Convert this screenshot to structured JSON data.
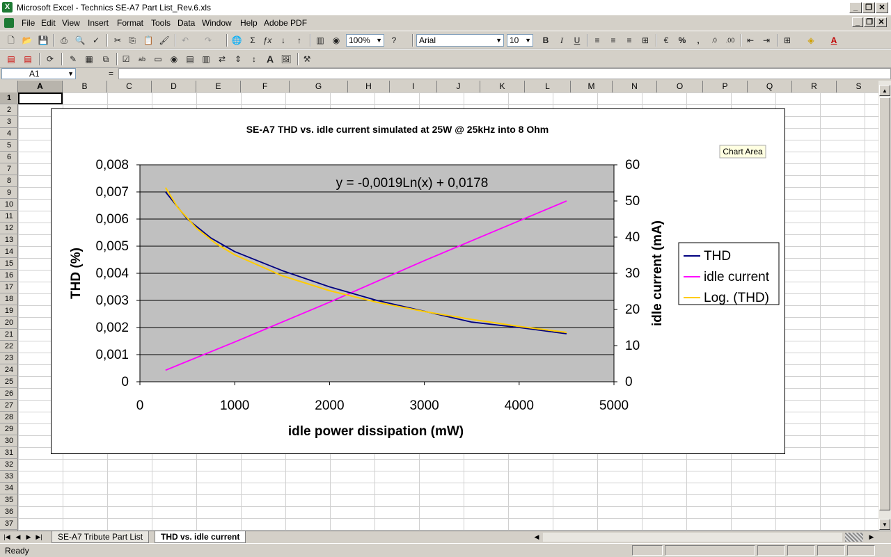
{
  "window": {
    "title": "Microsoft Excel - Technics SE-A7 Part List_Rev.6.xls",
    "app_icon": "X"
  },
  "menu": [
    "File",
    "Edit",
    "View",
    "Insert",
    "Format",
    "Tools",
    "Data",
    "Window",
    "Help",
    "Adobe PDF"
  ],
  "toolbar": {
    "zoom": "100%",
    "font": "Arial",
    "font_size": "10",
    "bold": "B",
    "italic": "I",
    "underline": "U",
    "percent": "%",
    "comma": ",",
    "draw_a": "A"
  },
  "formula_bar": {
    "name_box": "A1",
    "equals": "="
  },
  "columns": [
    "A",
    "B",
    "C",
    "D",
    "E",
    "F",
    "G",
    "H",
    "I",
    "J",
    "K",
    "L",
    "M",
    "N",
    "O",
    "P",
    "Q",
    "R",
    "S"
  ],
  "rows": [
    "1",
    "2",
    "3",
    "4",
    "5",
    "6",
    "7",
    "8",
    "9",
    "10",
    "11",
    "12",
    "13",
    "14",
    "15",
    "16",
    "17",
    "18",
    "19",
    "20",
    "21",
    "22",
    "23",
    "24",
    "25",
    "26",
    "27",
    "28",
    "29",
    "30",
    "31",
    "32",
    "33",
    "34",
    "35",
    "36",
    "37"
  ],
  "chart_data": {
    "type": "line",
    "title": "SE-A7 THD vs. idle current simulated at 25W @ 25kHz into 8 Ohm",
    "xlabel": "idle power dissipation (mW)",
    "ylabel": "THD (%)",
    "y2label": "idle current (mA)",
    "xlim": [
      0,
      5000
    ],
    "ylim": [
      0,
      0.008
    ],
    "y2lim": [
      0,
      60
    ],
    "x_ticks": [
      "0",
      "1000",
      "2000",
      "3000",
      "4000",
      "5000"
    ],
    "y_ticks": [
      "0",
      "0,001",
      "0,002",
      "0,003",
      "0,004",
      "0,005",
      "0,006",
      "0,007",
      "0,008"
    ],
    "y2_ticks": [
      "0",
      "10",
      "20",
      "30",
      "40",
      "50",
      "60"
    ],
    "trendline_equation": "y = -0,0019Ln(x) + 0,0178",
    "chart_area_tooltip": "Chart Area",
    "plot_background": "#c0c0c0",
    "grid": true,
    "legend_position": "right",
    "series": [
      {
        "name": "THD",
        "axis": "left",
        "color": "#000080",
        "x": [
          270,
          500,
          750,
          1000,
          1500,
          2000,
          2500,
          3000,
          3500,
          4000,
          4500
        ],
        "values": [
          0.007,
          0.006,
          0.0053,
          0.0048,
          0.0041,
          0.0035,
          0.003,
          0.0026,
          0.0022,
          0.002,
          0.00177
        ]
      },
      {
        "name": "idle current",
        "axis": "right",
        "color": "#ff00ff",
        "x": [
          270,
          1000,
          2000,
          3000,
          4000,
          4500
        ],
        "values": [
          3.2,
          11,
          22,
          33.5,
          44.5,
          50
        ]
      },
      {
        "name": "Log. (THD)",
        "axis": "left",
        "color": "#ffcc00",
        "x": [
          270,
          400,
          600,
          800,
          1000,
          1500,
          2000,
          2500,
          3000,
          3500,
          4000,
          4500
        ],
        "values": [
          0.00716,
          0.00642,
          0.00565,
          0.0051,
          0.00468,
          0.00391,
          0.00336,
          0.00293,
          0.00259,
          0.0023,
          0.00204,
          0.00182
        ]
      }
    ]
  },
  "sheet_tabs": [
    "SE-A7 Tribute Part List",
    "THD vs. idle current"
  ],
  "status": "Ready"
}
